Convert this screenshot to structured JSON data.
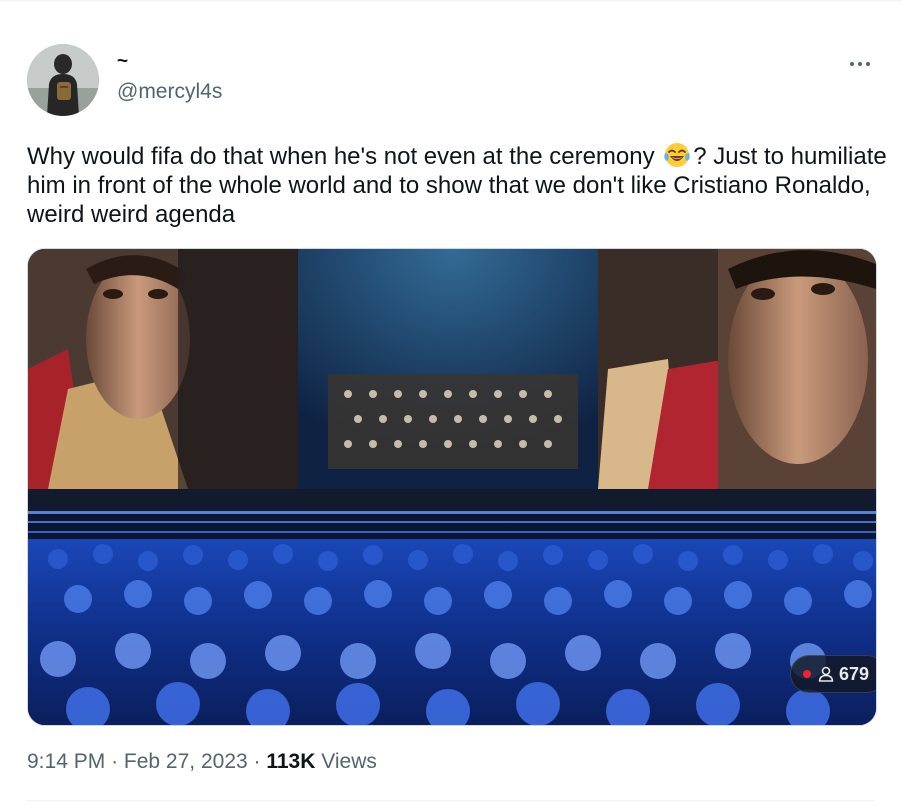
{
  "author": {
    "display_name": "~",
    "handle": "@mercyl4s"
  },
  "tweet": {
    "text_part1": "Why would fifa do that when he's not even at the ceremony ",
    "emoji": "😂",
    "text_part2": "? Just to humiliate him in front of the whole world and to show that we don't like Cristiano Ronaldo, weird weird agenda"
  },
  "media": {
    "viewer_count": "679",
    "live_indicator_color": "#f4212e"
  },
  "meta": {
    "time": "9:14 PM",
    "separator": "·",
    "date": "Feb 27, 2023",
    "views_count": "113K",
    "views_label": "Views"
  },
  "icons": {
    "more": "more-horizontal-icon",
    "viewers": "person-outline-icon",
    "emoji": "face-with-tears-of-joy-icon"
  }
}
